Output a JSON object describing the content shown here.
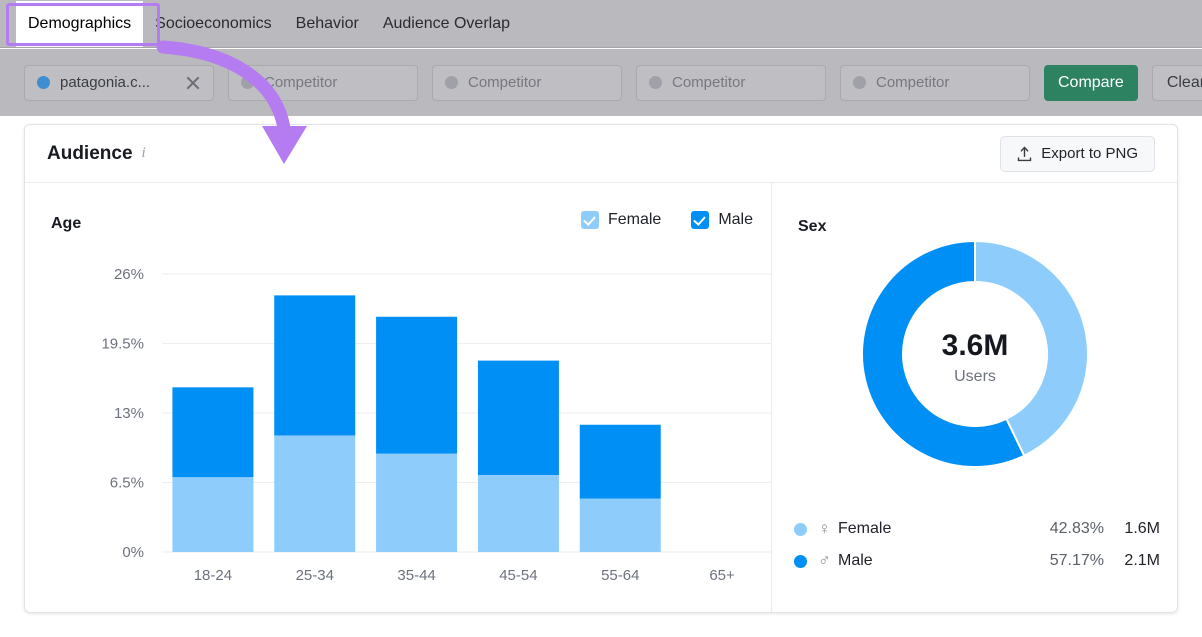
{
  "tabs": [
    {
      "label": "Demographics",
      "active": true
    },
    {
      "label": "Socioeconomics",
      "active": false
    },
    {
      "label": "Behavior",
      "active": false
    },
    {
      "label": "Audience Overlap",
      "active": false
    }
  ],
  "competitor_bar": {
    "items": [
      {
        "label": "patagonia.c...",
        "dot": "blue-dot",
        "has_close": true
      },
      {
        "label": "Competitor",
        "dot": "grey-dot",
        "has_close": false
      },
      {
        "label": "Competitor",
        "dot": "grey-dot",
        "has_close": false
      },
      {
        "label": "Competitor",
        "dot": "grey-dot",
        "has_close": false
      },
      {
        "label": "Competitor",
        "dot": "grey-dot",
        "has_close": false
      }
    ],
    "compare_label": "Compare",
    "clear_label": "Clear"
  },
  "card": {
    "title": "Audience",
    "info_icon": "info-icon",
    "export_label": "Export to PNG",
    "export_icon": "upload-icon"
  },
  "age_panel": {
    "title": "Age",
    "legend": [
      {
        "label": "Female",
        "checked": true,
        "color": "#8ecdfb"
      },
      {
        "label": "Male",
        "checked": true,
        "color": "#008ff5"
      }
    ]
  },
  "sex_panel": {
    "title": "Sex",
    "center_value": "3.6M",
    "center_label": "Users",
    "rows": [
      {
        "name": "Female",
        "symbol": "♀",
        "percent": "42.83%",
        "users": "1.6M",
        "color": "#8ecdfb"
      },
      {
        "name": "Male",
        "symbol": "♂",
        "percent": "57.17%",
        "users": "2.1M",
        "color": "#008ff5"
      }
    ]
  },
  "colors": {
    "female": "#8ecdfb",
    "male": "#008ff5",
    "compare_green": "#2d8261",
    "highlight_purple": "#b57bf0",
    "grid": "#eceef2",
    "axis_text": "#6d7280"
  },
  "chart_data": {
    "type": "bar",
    "title": "Age",
    "stacked": true,
    "xlabel": "",
    "ylabel": "",
    "grid": true,
    "legend_position": "top-right",
    "categories": [
      "18-24",
      "25-34",
      "35-44",
      "45-54",
      "55-64",
      "65+"
    ],
    "ytick_labels": [
      "0%",
      "6.5%",
      "13%",
      "19.5%",
      "26%"
    ],
    "ytick_values": [
      0,
      6.5,
      13,
      19.5,
      26
    ],
    "ylim": [
      0,
      26
    ],
    "series": [
      {
        "name": "Female",
        "color": "#8ecdfb",
        "values": [
          7.0,
          10.9,
          9.2,
          7.2,
          5.0,
          0
        ]
      },
      {
        "name": "Male",
        "color": "#008ff5",
        "values": [
          8.4,
          13.1,
          12.8,
          10.7,
          6.9,
          0
        ]
      }
    ],
    "totals": [
      15.4,
      24.0,
      22.0,
      17.9,
      11.9,
      0
    ]
  },
  "donut_data": {
    "type": "pie",
    "title": "Sex",
    "center_value": "3.6M",
    "center_label": "Users",
    "slices": [
      {
        "label": "Female",
        "percent": 42.83,
        "users": "1.6M",
        "color": "#8ecdfb"
      },
      {
        "label": "Male",
        "percent": 57.17,
        "users": "2.1M",
        "color": "#008ff5"
      }
    ]
  }
}
